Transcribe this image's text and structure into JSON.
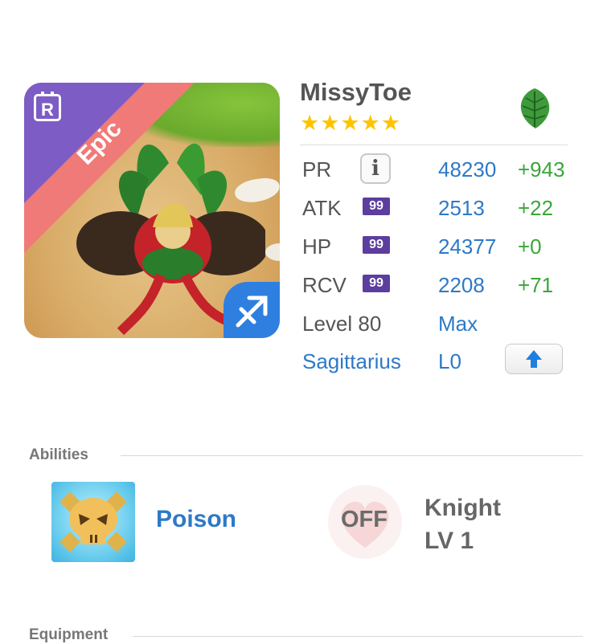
{
  "unit": {
    "name": "MissyToe",
    "stars": "★★★★★",
    "rarity": "Epic",
    "rarity_icon_letter": "R",
    "element_icon": "leaf-icon",
    "sign_icon": "sagittarius-icon"
  },
  "stats": {
    "pr": {
      "label": "PR",
      "value": "48230",
      "bonus": "+943"
    },
    "atk": {
      "label": "ATK",
      "badge": "99",
      "value": "2513",
      "bonus": "+22"
    },
    "hp": {
      "label": "HP",
      "badge": "99",
      "value": "24377",
      "bonus": "+0"
    },
    "rcv": {
      "label": "RCV",
      "badge": "99",
      "value": "2208",
      "bonus": "+71"
    },
    "level": {
      "label": "Level 80",
      "value": "Max"
    },
    "sign": {
      "label": "Sagittarius",
      "value": "L0"
    }
  },
  "abilities": {
    "title": "Abilities",
    "primary": {
      "name": "Poison",
      "icon": "skull-icon"
    },
    "secondary": {
      "state": "OFF",
      "name": "Knight",
      "level": "LV 1",
      "icon": "heart-icon"
    }
  },
  "equipment": {
    "title": "Equipment"
  },
  "colors": {
    "accent_blue": "#2d79c7",
    "bonus_green": "#3aa63a",
    "epic_ribbon": "#f07a78",
    "rarity_purple": "#7d5cc6",
    "star_gold": "#ffc400",
    "badge_purple": "#5b3e9e"
  }
}
